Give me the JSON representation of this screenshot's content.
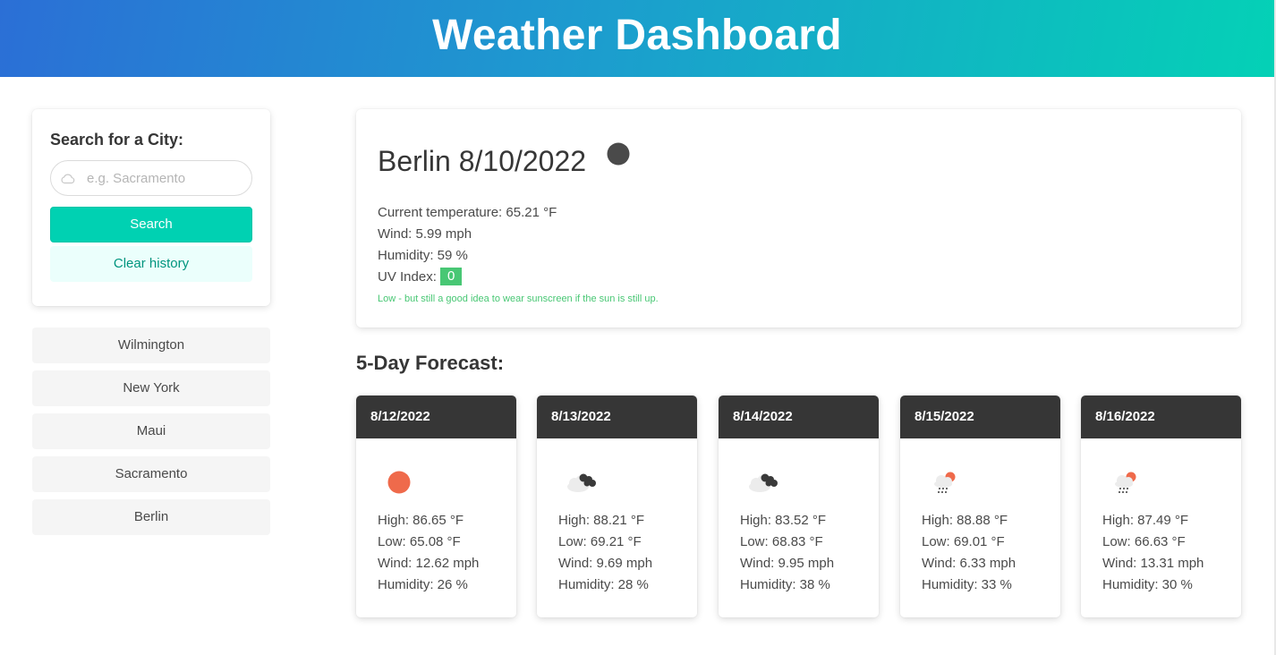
{
  "header": {
    "title": "Weather Dashboard"
  },
  "search": {
    "title": "Search for a City:",
    "placeholder": "e.g. Sacramento",
    "input_icon": "cloud-icon",
    "search_label": "Search",
    "clear_label": "Clear history"
  },
  "history": [
    "Wilmington",
    "New York",
    "Maui",
    "Sacramento",
    "Berlin"
  ],
  "current": {
    "title": "Berlin 8/10/2022",
    "icon": "weather-icon",
    "temperature": "Current temperature: 65.21 °F",
    "wind": "Wind: 5.99 mph",
    "humidity": "Humidity: 59 %",
    "uv_label": "UV Index:",
    "uv_value": "0",
    "uv_note": "Low - but still a good idea to wear sunscreen if the sun is still up."
  },
  "forecast": {
    "title": "5-Day Forecast:",
    "days": [
      {
        "date": "8/12/2022",
        "icon": "sunny-icon",
        "high": "High: 86.65 °F",
        "low": "Low: 65.08 °F",
        "wind": "Wind: 12.62 mph",
        "humidity": "Humidity: 26 %"
      },
      {
        "date": "8/13/2022",
        "icon": "cloudy-icon",
        "high": "High: 88.21 °F",
        "low": "Low: 69.21 °F",
        "wind": "Wind: 9.69 mph",
        "humidity": "Humidity: 28 %"
      },
      {
        "date": "8/14/2022",
        "icon": "cloudy-icon",
        "high": "High: 83.52 °F",
        "low": "Low: 68.83 °F",
        "wind": "Wind: 9.95 mph",
        "humidity": "Humidity: 38 %"
      },
      {
        "date": "8/15/2022",
        "icon": "rain-sun-icon",
        "high": "High: 88.88 °F",
        "low": "Low: 69.01 °F",
        "wind": "Wind: 6.33 mph",
        "humidity": "Humidity: 33 %"
      },
      {
        "date": "8/16/2022",
        "icon": "rain-sun-icon",
        "high": "High: 87.49 °F",
        "low": "Low: 66.63 °F",
        "wind": "Wind: 13.31 mph",
        "humidity": "Humidity: 30 %"
      }
    ]
  },
  "colors": {
    "accent": "#00d1b2",
    "uv_low": "#48c774",
    "card_header": "#363636",
    "sun": "#ef6a4b"
  }
}
